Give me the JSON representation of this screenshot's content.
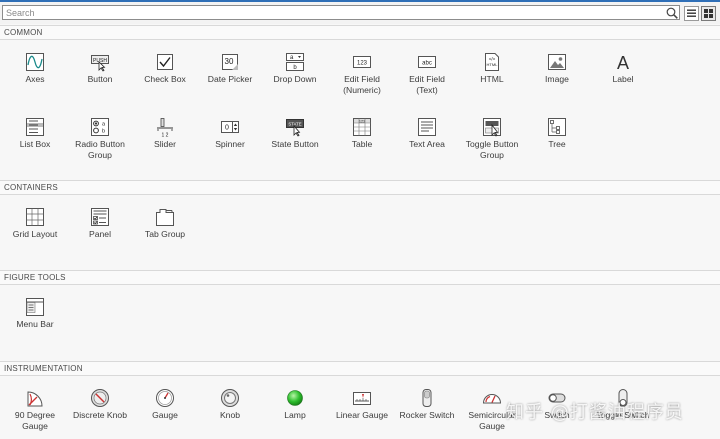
{
  "search": {
    "placeholder": "Search",
    "value": ""
  },
  "sections": {
    "common": "COMMON",
    "containers": "CONTAINERS",
    "figure_tools": "FIGURE TOOLS",
    "instrumentation": "INSTRUMENTATION"
  },
  "common": [
    {
      "label": "Axes",
      "icon": "axes-icon"
    },
    {
      "label": "Button",
      "icon": "button-icon",
      "icon_text": "PUSH"
    },
    {
      "label": "Check Box",
      "icon": "check-box-icon"
    },
    {
      "label": "Date Picker",
      "icon": "date-picker-icon",
      "icon_text": "30"
    },
    {
      "label": "Drop Down",
      "icon": "drop-down-icon",
      "icon_text": "a"
    },
    {
      "label": "Edit Field\n(Numeric)",
      "icon": "edit-field-numeric-icon",
      "icon_text": "123"
    },
    {
      "label": "Edit Field\n(Text)",
      "icon": "edit-field-text-icon",
      "icon_text": "abc"
    },
    {
      "label": "HTML",
      "icon": "html-icon",
      "icon_text": "HTML"
    },
    {
      "label": "Image",
      "icon": "image-icon"
    },
    {
      "label": "Label",
      "icon": "label-icon",
      "icon_text": "A"
    },
    {
      "label": "List Box",
      "icon": "list-box-icon"
    },
    {
      "label": "Radio Button\nGroup",
      "icon": "radio-button-group-icon"
    },
    {
      "label": "Slider",
      "icon": "slider-icon",
      "icon_text": "1 2"
    },
    {
      "label": "Spinner",
      "icon": "spinner-icon",
      "icon_text": "0"
    },
    {
      "label": "State Button",
      "icon": "state-button-icon",
      "icon_text": "STATE"
    },
    {
      "label": "Table",
      "icon": "table-icon",
      "icon_text": "123"
    },
    {
      "label": "Text Area",
      "icon": "text-area-icon"
    },
    {
      "label": "Toggle Button\nGroup",
      "icon": "toggle-button-group-icon"
    },
    {
      "label": "Tree",
      "icon": "tree-icon"
    }
  ],
  "containers": [
    {
      "label": "Grid Layout",
      "icon": "grid-layout-icon"
    },
    {
      "label": "Panel",
      "icon": "panel-icon"
    },
    {
      "label": "Tab Group",
      "icon": "tab-group-icon"
    }
  ],
  "figure_tools": [
    {
      "label": "Menu Bar",
      "icon": "menu-bar-icon"
    }
  ],
  "instrumentation": [
    {
      "label": "90 Degree\nGauge",
      "icon": "ninety-degree-gauge-icon"
    },
    {
      "label": "Discrete Knob",
      "icon": "discrete-knob-icon"
    },
    {
      "label": "Gauge",
      "icon": "gauge-icon"
    },
    {
      "label": "Knob",
      "icon": "knob-icon"
    },
    {
      "label": "Lamp",
      "icon": "lamp-icon"
    },
    {
      "label": "Linear Gauge",
      "icon": "linear-gauge-icon"
    },
    {
      "label": "Rocker Switch",
      "icon": "rocker-switch-icon"
    },
    {
      "label": "Semicircular\nGauge",
      "icon": "semicircular-gauge-icon"
    },
    {
      "label": "Switch",
      "icon": "switch-icon"
    },
    {
      "label": "Toggle Switch",
      "icon": "toggle-switch-icon"
    }
  ],
  "watermark": "知乎 @打酱油程序员",
  "colors": {
    "accent": "#2f6fb7",
    "lamp": "#2fbf2f",
    "axes_line": "#1a8a8a"
  }
}
